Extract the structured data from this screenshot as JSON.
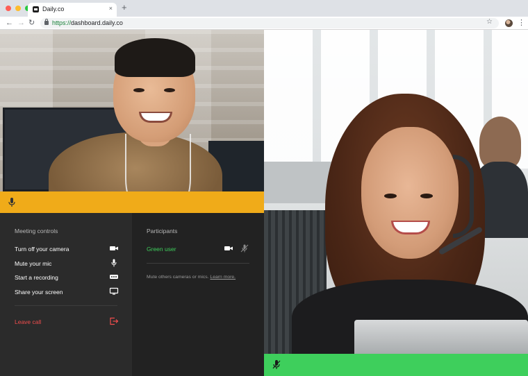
{
  "browser": {
    "traffic_lights": [
      "#ff5f57",
      "#febc2e",
      "#28c840"
    ],
    "tab_title": "Daily.co",
    "tab_close": "×",
    "new_tab": "+",
    "nav": {
      "back": "←",
      "forward": "→",
      "reload": "↻"
    },
    "url_scheme": "https://",
    "url_host": "dashboard.daily.co",
    "bookmark": "☆",
    "menu": "⋮"
  },
  "call": {
    "tiles": [
      {
        "name": "local-video",
        "strip_color": "#f0ab19",
        "mic_state": "mic-icon"
      },
      {
        "name": "remote-video",
        "strip_color": "#3ecf5c",
        "mic_state": "mic-off-icon"
      }
    ],
    "meeting_controls": {
      "title": "Meeting controls",
      "items": [
        {
          "label": "Turn off your camera",
          "icon": "camera-icon"
        },
        {
          "label": "Mute your mic",
          "icon": "mic-icon"
        },
        {
          "label": "Start a recording",
          "icon": "record-icon"
        },
        {
          "label": "Share your screen",
          "icon": "screen-share-icon"
        }
      ],
      "leave": {
        "label": "Leave call",
        "icon": "leave-icon",
        "color": "#f04d4d"
      }
    },
    "participants": {
      "title": "Participants",
      "list": [
        {
          "name": "Green user",
          "color": "#3ecf5c",
          "icons": [
            "camera-icon",
            "mic-off-icon"
          ]
        }
      ],
      "hint": "Mute others cameras or mics.",
      "hint_link": "Learn more."
    }
  }
}
